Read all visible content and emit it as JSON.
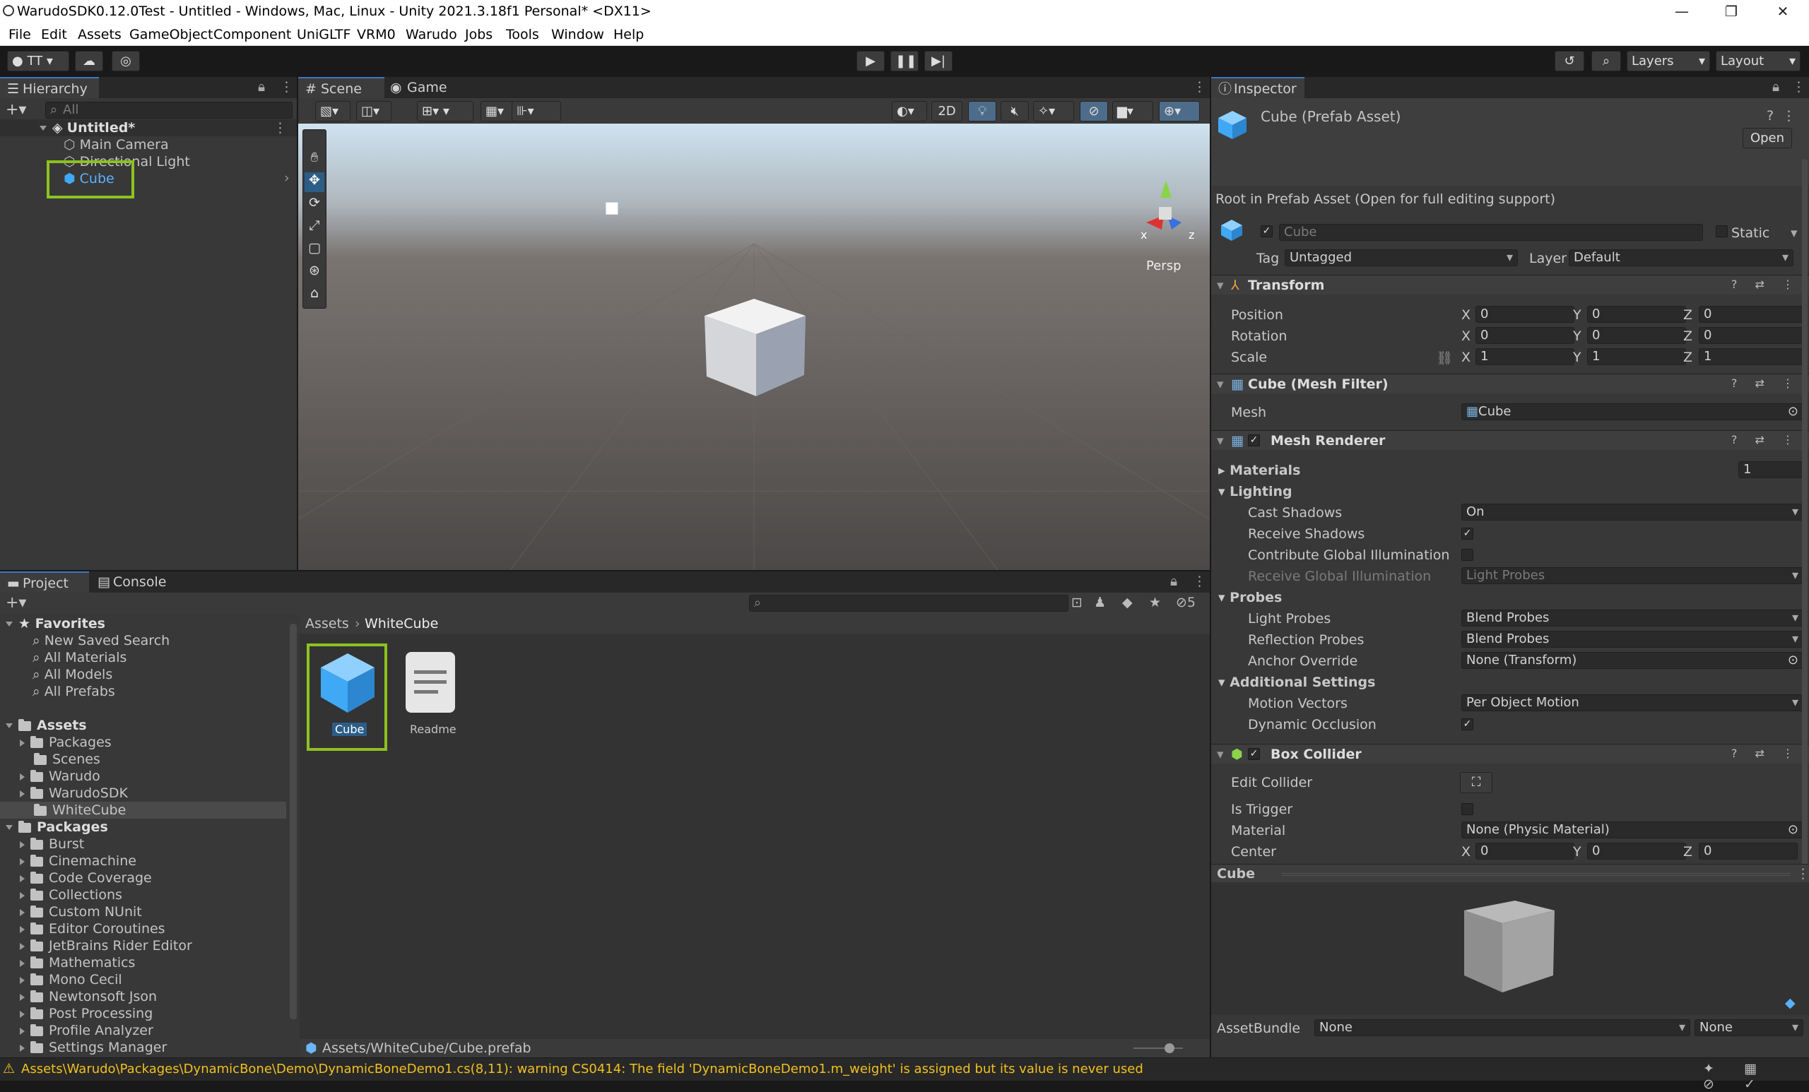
{
  "window": {
    "title": "WarudoSDK0.12.0Test - Untitled - Windows, Mac, Linux - Unity 2021.3.18f1 Personal* <DX11>"
  },
  "menu": [
    "File",
    "Edit",
    "Assets",
    "GameObject",
    "Component",
    "UniGLTF",
    "VRM0",
    "Warudo",
    "Jobs",
    "Tools",
    "Window",
    "Help"
  ],
  "toolbar": {
    "account": "TT",
    "layers": "Layers",
    "layout": "Layout"
  },
  "hierarchy": {
    "tab": "Hierarchy",
    "search_placeholder": "All",
    "scene": "Untitled*",
    "items": [
      "Main Camera",
      "Directional Light",
      "Cube"
    ]
  },
  "scene": {
    "tabs": [
      "Scene",
      "Game"
    ],
    "persp": "Persp",
    "toggle_2d": "2D",
    "gizmo_x": "x",
    "gizmo_z": "z"
  },
  "project": {
    "tabs": [
      "Project",
      "Console"
    ],
    "hidden_count": "5",
    "favorites_label": "Favorites",
    "favorites": [
      "New Saved Search",
      "All Materials",
      "All Models",
      "All Prefabs"
    ],
    "assets_label": "Assets",
    "assets": [
      "Packages",
      "Scenes",
      "Warudo",
      "WarudoSDK",
      "WhiteCube"
    ],
    "packages_label": "Packages",
    "packages": [
      "Burst",
      "Cinemachine",
      "Code Coverage",
      "Collections",
      "Custom NUnit",
      "Editor Coroutines",
      "JetBrains Rider Editor",
      "Mathematics",
      "Mono Cecil",
      "Newtonsoft Json",
      "Post Processing",
      "Profile Analyzer",
      "Settings Manager"
    ],
    "breadcrumb": [
      "Assets",
      "WhiteCube"
    ],
    "files": [
      "Cube",
      "Readme"
    ],
    "footer_path": "Assets/WhiteCube/Cube.prefab"
  },
  "inspector": {
    "tab": "Inspector",
    "asset_title": "Cube (Prefab Asset)",
    "open_label": "Open",
    "root_note": "Root in Prefab Asset (Open for full editing support)",
    "name": "Cube",
    "static_label": "Static",
    "tag_label": "Tag",
    "tag_value": "Untagged",
    "layer_label": "Layer",
    "layer_value": "Default",
    "transform": {
      "title": "Transform",
      "position_label": "Position",
      "rotation_label": "Rotation",
      "scale_label": "Scale",
      "position": [
        "0",
        "0",
        "0"
      ],
      "rotation": [
        "0",
        "0",
        "0"
      ],
      "scale": [
        "1",
        "1",
        "1"
      ],
      "axes": [
        "X",
        "Y",
        "Z"
      ]
    },
    "mesh_filter": {
      "title": "Cube (Mesh Filter)",
      "mesh_label": "Mesh",
      "mesh_value": "Cube"
    },
    "mesh_renderer": {
      "title": "Mesh Renderer",
      "materials_label": "Materials",
      "materials_count": "1",
      "lighting_label": "Lighting",
      "cast_shadows_label": "Cast Shadows",
      "cast_shadows": "On",
      "receive_shadows_label": "Receive Shadows",
      "contribute_gi_label": "Contribute Global Illumination",
      "receive_gi_label": "Receive Global Illumination",
      "receive_gi": "Light Probes",
      "probes_label": "Probes",
      "light_probes_label": "Light Probes",
      "light_probes": "Blend Probes",
      "reflection_probes_label": "Reflection Probes",
      "reflection_probes": "Blend Probes",
      "anchor_label": "Anchor Override",
      "anchor": "None (Transform)",
      "additional_label": "Additional Settings",
      "motion_label": "Motion Vectors",
      "motion": "Per Object Motion",
      "dynamic_occlusion_label": "Dynamic Occlusion"
    },
    "box_collider": {
      "title": "Box Collider",
      "edit_label": "Edit Collider",
      "trigger_label": "Is Trigger",
      "material_label": "Material",
      "material": "None (Physic Material)",
      "center_label": "Center",
      "center": [
        "0",
        "0",
        "0"
      ]
    },
    "preview_title": "Cube",
    "assetbundle_label": "AssetBundle",
    "assetbundle": "None",
    "assetbundle_variant": "None"
  },
  "status": {
    "message": "Assets\\Warudo\\Packages\\DynamicBone\\Demo\\DynamicBoneDemo1.cs(8,11): warning CS0414: The field 'DynamicBoneDemo1.m_weight' is assigned but its value is never used"
  },
  "colors": {
    "highlight": "#8dc21f",
    "selection": "#2c5d87",
    "cube_blue": "#3fa9f5",
    "warning": "#f0c020"
  }
}
